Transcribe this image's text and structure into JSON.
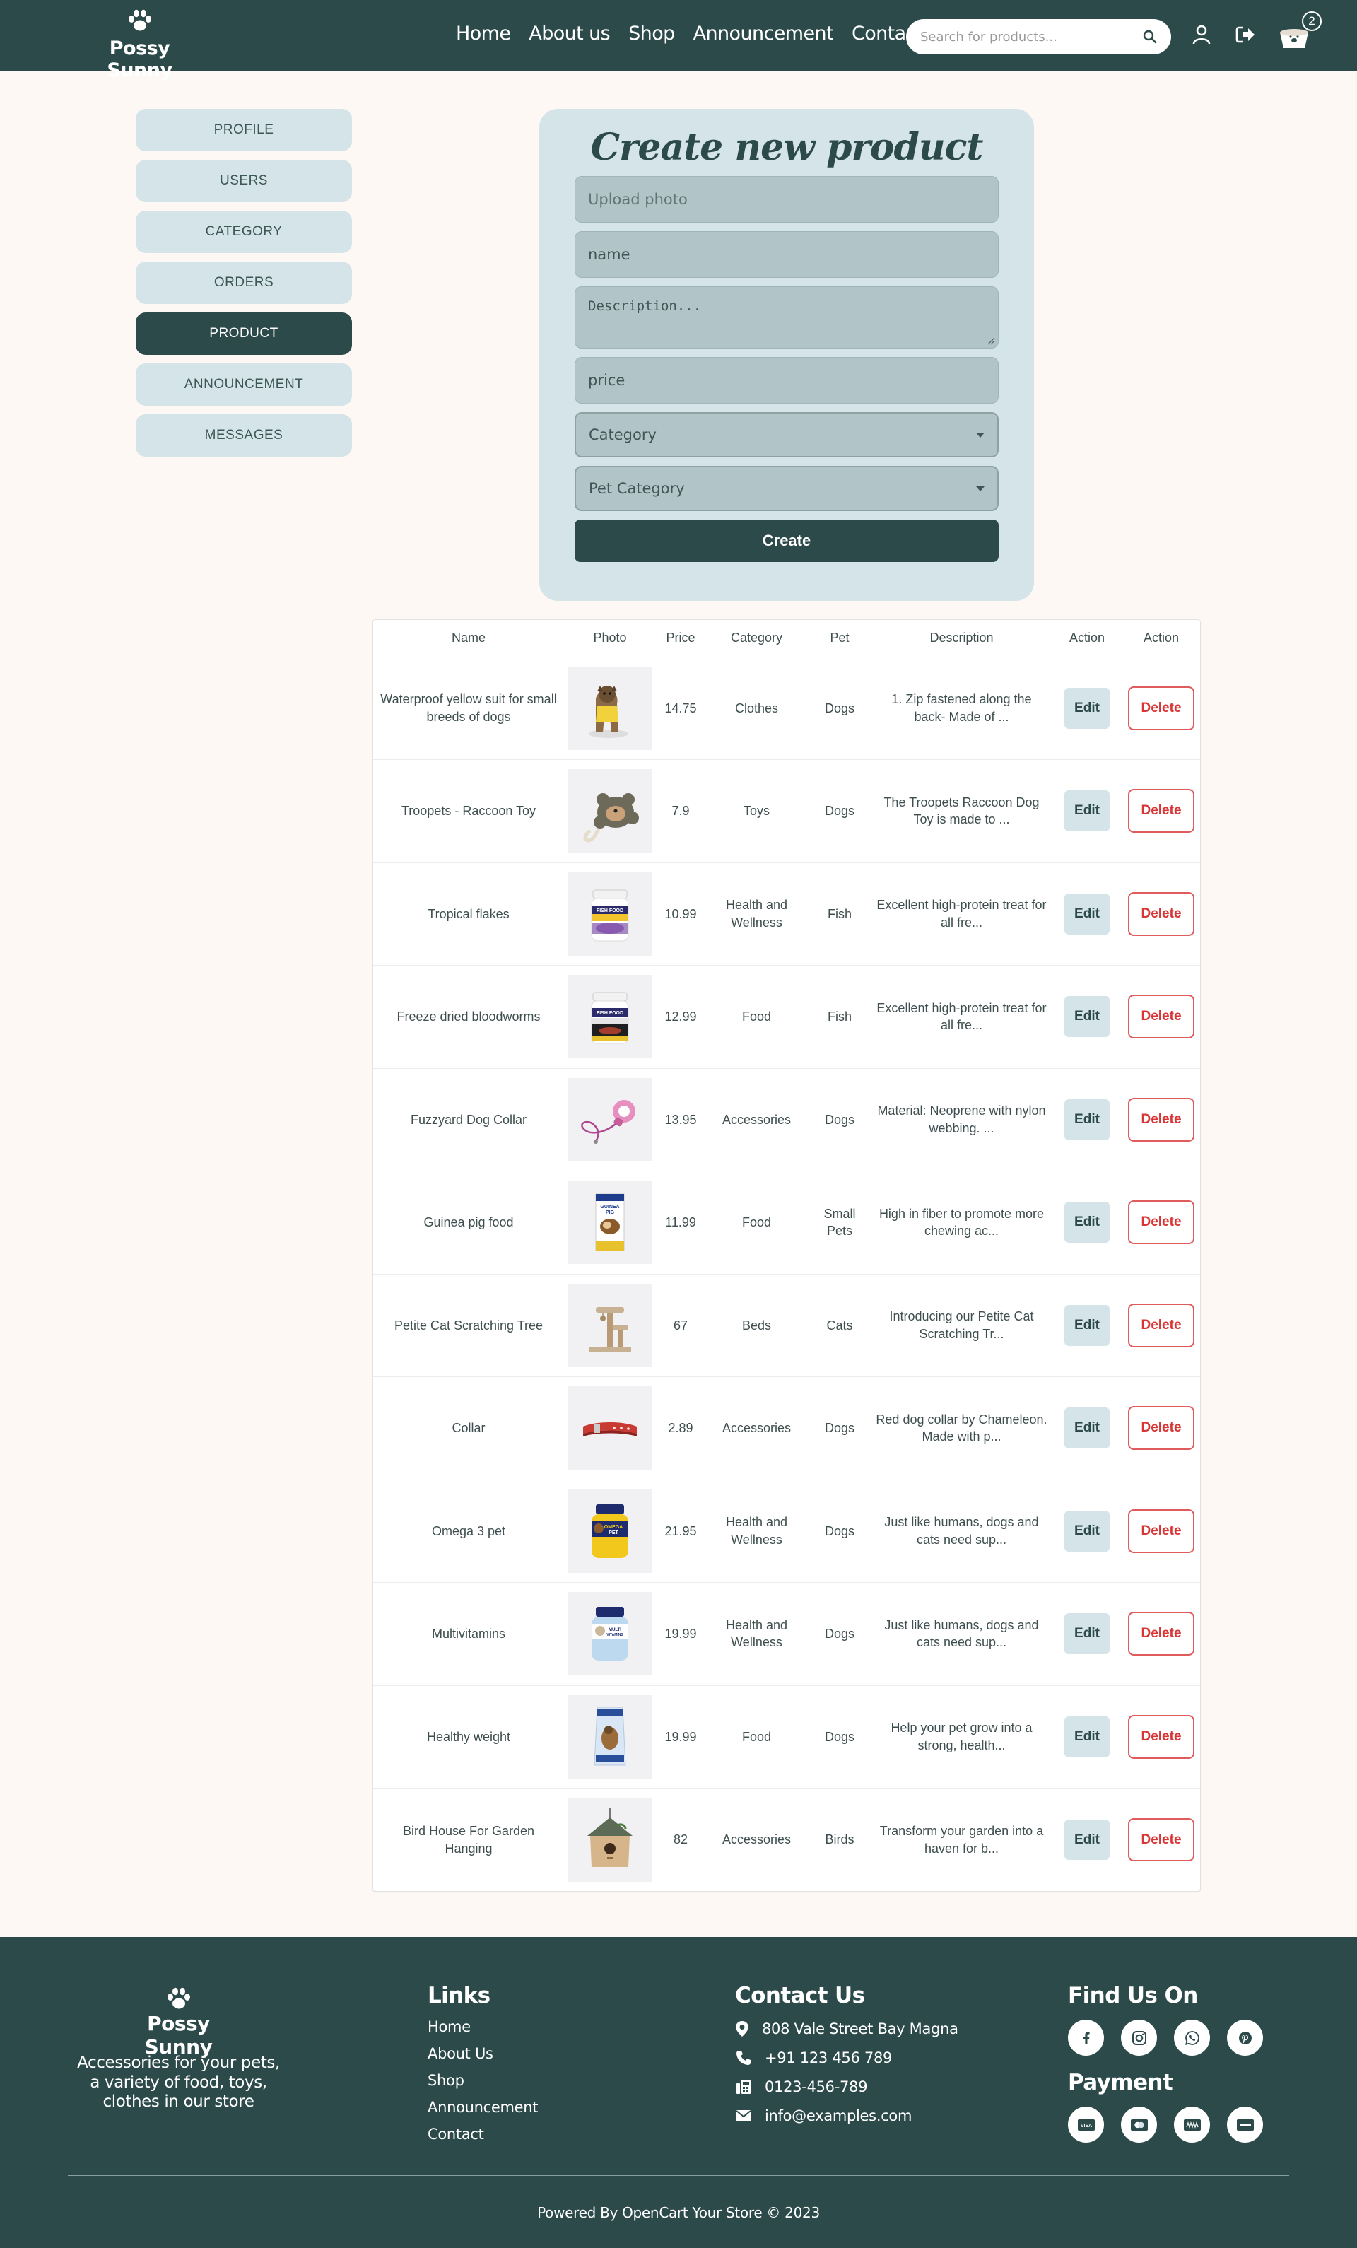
{
  "header": {
    "brand": "Possy Sunny",
    "nav": [
      "Home",
      "About us",
      "Shop",
      "Announcement",
      "Contact"
    ],
    "search_placeholder": "Search for products...",
    "cart_count": "2"
  },
  "sidebar": {
    "items": [
      "PROFILE",
      "USERS",
      "CATEGORY",
      "ORDERS",
      "PRODUCT",
      "ANNOUNCEMENT",
      "MESSAGES"
    ],
    "active": "PRODUCT"
  },
  "form": {
    "title": "Create new product",
    "upload_placeholder": "Upload photo",
    "name_placeholder": "name",
    "description_placeholder": "Description...",
    "price_placeholder": "price",
    "category_selected": "Category",
    "pet_category_selected": "Pet Category",
    "submit_label": "Create"
  },
  "table": {
    "headers": [
      "Name",
      "Photo",
      "Price",
      "Category",
      "Pet",
      "Description",
      "Action",
      "Action"
    ],
    "edit_label": "Edit",
    "delete_label": "Delete",
    "rows": [
      {
        "name": "Waterproof yellow suit for small breeds of dogs",
        "price": "14.75",
        "category": "Clothes",
        "pet": "Dogs",
        "description": "1. Zip fastened along the back- Made of ...",
        "photo": "dog-yellow-suit"
      },
      {
        "name": "Troopets - Raccoon Toy",
        "price": "7.9",
        "category": "Toys",
        "pet": "Dogs",
        "description": "The Troopets Raccoon Dog Toy is made to ...",
        "photo": "raccoon-toy"
      },
      {
        "name": "Tropical flakes",
        "price": "10.99",
        "category": "Health and Wellness",
        "pet": "Fish",
        "description": "Excellent high-protein treat for all fre...",
        "photo": "fish-food-jar"
      },
      {
        "name": "Freeze dried bloodworms",
        "price": "12.99",
        "category": "Food",
        "pet": "Fish",
        "description": "Excellent high-protein treat for all fre...",
        "photo": "fish-food-jar-dark"
      },
      {
        "name": "Fuzzyard Dog Collar",
        "price": "13.95",
        "category": "Accessories",
        "pet": "Dogs",
        "description": "Material: Neoprene with nylon webbing. ...",
        "photo": "pink-leash"
      },
      {
        "name": "Guinea pig food",
        "price": "11.99",
        "category": "Food",
        "pet": "Small Pets",
        "description": "High in fiber to promote more chewing ac...",
        "photo": "guinea-pig-box"
      },
      {
        "name": "Petite Cat Scratching Tree",
        "price": "67",
        "category": "Beds",
        "pet": "Cats",
        "description": "Introducing our Petite Cat Scratching Tr...",
        "photo": "cat-tree"
      },
      {
        "name": "Collar",
        "price": "2.89",
        "category": "Accessories",
        "pet": "Dogs",
        "description": "Red dog collar by Chameleon. Made with p...",
        "photo": "red-collar"
      },
      {
        "name": "Omega 3 pet",
        "price": "21.95",
        "category": "Health and Wellness",
        "pet": "Dogs",
        "description": "Just like humans, dogs and cats need sup...",
        "photo": "omega-jar"
      },
      {
        "name": "Multivitamins",
        "price": "19.99",
        "category": "Health and Wellness",
        "pet": "Dogs",
        "description": "Just like humans, dogs and cats need sup...",
        "photo": "multivitamin-jar"
      },
      {
        "name": "Healthy weight",
        "price": "19.99",
        "category": "Food",
        "pet": "Dogs",
        "description": "Help your pet grow into a strong, health...",
        "photo": "dog-food-bag"
      },
      {
        "name": "Bird House For Garden Hanging",
        "price": "82",
        "category": "Accessories",
        "pet": "Birds",
        "description": "Transform your garden into a haven for b...",
        "photo": "bird-house"
      }
    ]
  },
  "footer": {
    "brand": "Possy Sunny",
    "tagline": "Accessories for your pets, a variety of food, toys, clothes in our store",
    "links_title": "Links",
    "links": [
      "Home",
      "About Us",
      "Shop",
      "Announcement",
      "Contact"
    ],
    "contact_title": "Contact Us",
    "address": "808 Vale Street Bay Magna",
    "phone": "+91 123 456 789",
    "fax": "0123-456-789",
    "email": "info@examples.com",
    "find_title": "Find Us On",
    "social_icons": [
      "facebook-icon",
      "instagram-icon",
      "whatsapp-icon",
      "pinterest-icon"
    ],
    "payment_title": "Payment",
    "payment_icons": [
      "visa-icon",
      "mastercard-icon",
      "paypal-icon",
      "amex-icon"
    ],
    "copyright": "Powered By OpenCart Your Store © 2023"
  },
  "colors": {
    "primary": "#2d4a4a",
    "light": "#d5e4e8",
    "input": "#b1c4c7",
    "background": "#fdf8f3",
    "danger": "#d93535"
  }
}
